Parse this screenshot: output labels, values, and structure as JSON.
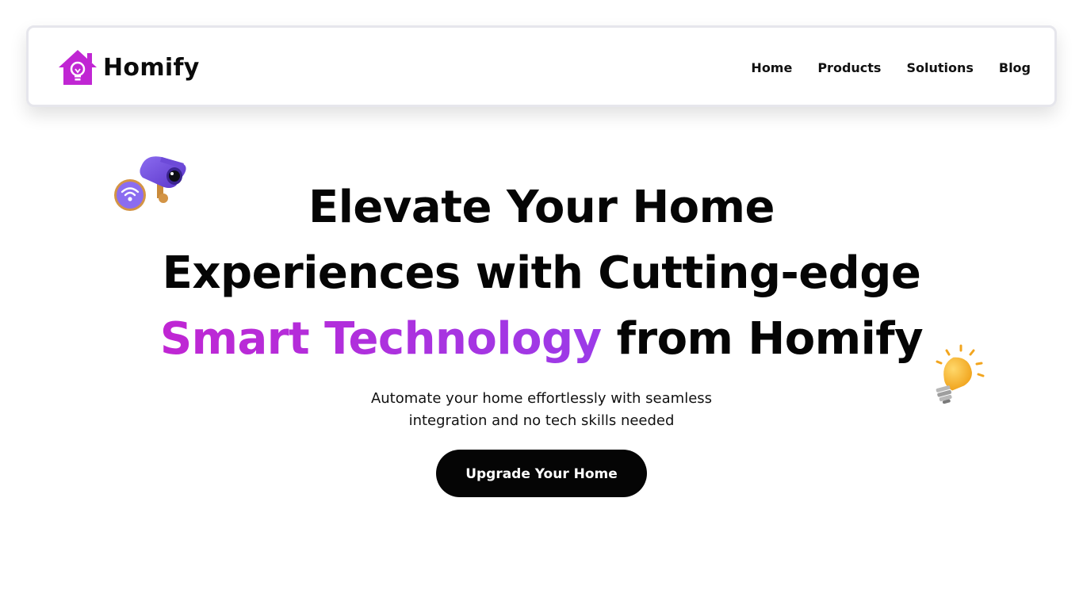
{
  "brand": {
    "name": "Homify",
    "logo_icon": "house-bulb-icon",
    "accent_color": "#c026d3"
  },
  "nav": {
    "items": [
      {
        "label": "Home"
      },
      {
        "label": "Products"
      },
      {
        "label": "Solutions"
      },
      {
        "label": "Blog"
      }
    ]
  },
  "hero": {
    "title_line1": "Elevate Your Home",
    "title_line2": "Experiences with Cutting-edge",
    "title_accent": "Smart Technology",
    "title_rest": " from Homify",
    "subtitle_line1": "Automate your home effortlessly with seamless",
    "subtitle_line2": "integration and no tech skills needed",
    "cta_label": "Upgrade Your Home",
    "accent_gradient": [
      "#c026d3",
      "#9b3be8"
    ]
  },
  "illustrations": {
    "left": "security-camera-wifi-icon",
    "right": "light-bulb-icon"
  }
}
